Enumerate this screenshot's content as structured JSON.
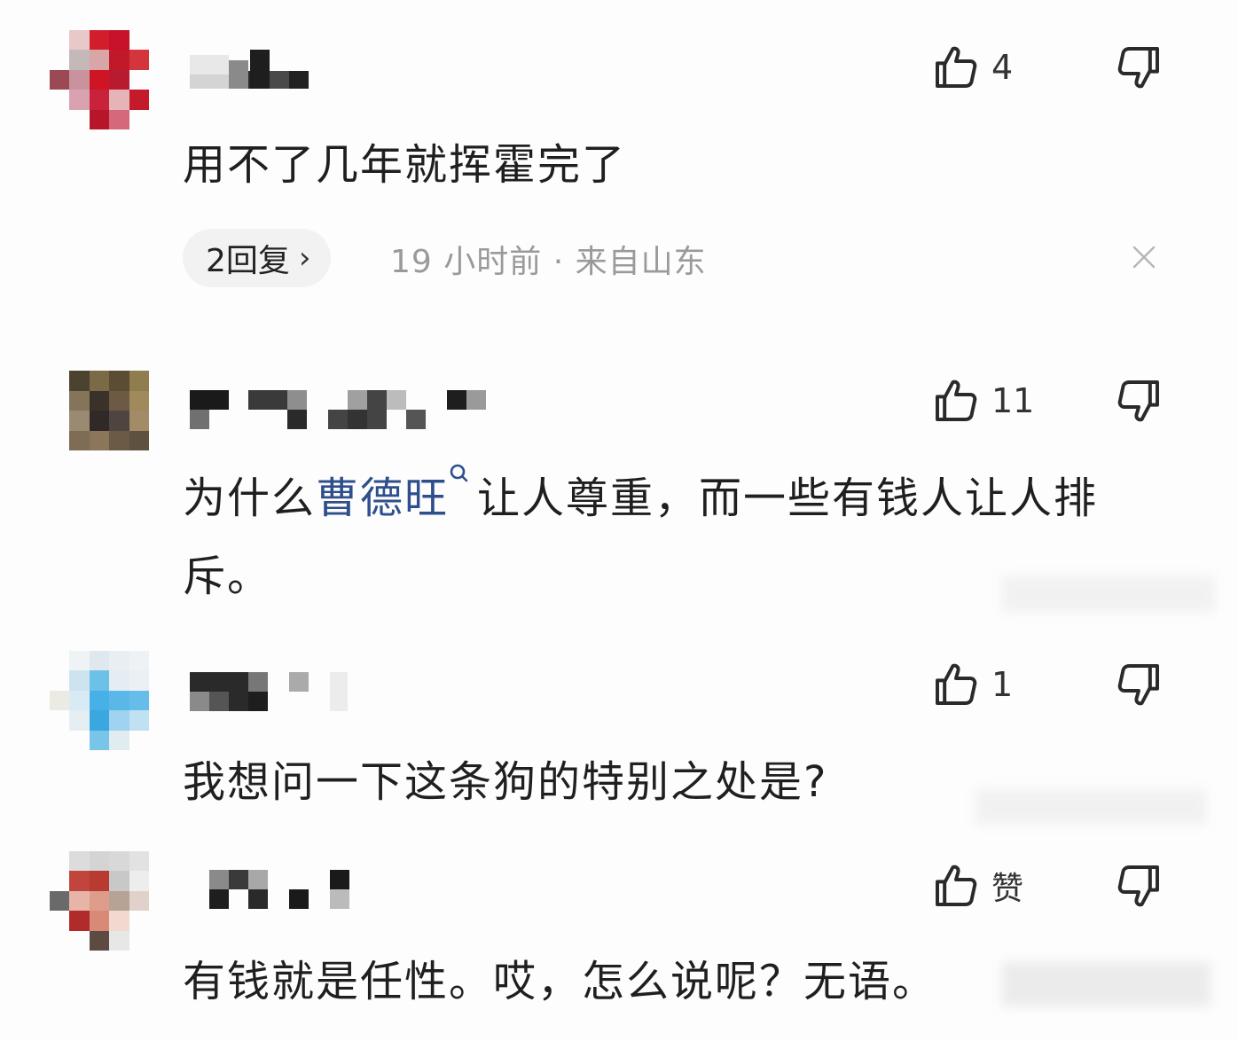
{
  "comments": [
    {
      "likes": "4",
      "text": "用不了几年就挥霍完了",
      "replies": "2回复",
      "meta": "19 小时前 · 来自山东"
    },
    {
      "likes": "11",
      "text_before": "为什么",
      "link": "曹德旺",
      "text_after": "让人尊重，而一些有钱人让人排斥。"
    },
    {
      "likes": "1",
      "text": "我想问一下这条狗的特别之处是?"
    },
    {
      "likes": "赞",
      "text": "有钱就是任性。哎，怎么说呢？无语。"
    }
  ],
  "icons": {
    "like": "thumbs-up-icon",
    "dislike": "thumbs-down-icon",
    "search": "search-icon",
    "close": "close-icon",
    "chevron": "chevron-right-icon"
  },
  "colors": {
    "link": "#2e4f8c",
    "meta": "#9a9a9a",
    "pill": "#f2f2f2"
  }
}
